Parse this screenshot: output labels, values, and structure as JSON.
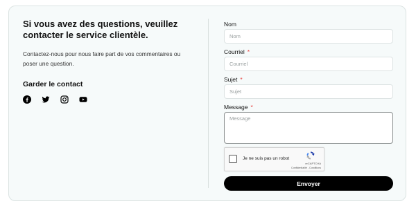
{
  "left": {
    "headline": "Si vous avez des questions, veuillez contacter le service clientèle.",
    "intro": "Contactez-nous pour nous faire part de vos commentaires ou poser une question.",
    "contact_title": "Garder le contact",
    "socials": [
      "facebook-icon",
      "twitter-icon",
      "instagram-icon",
      "youtube-icon"
    ]
  },
  "form": {
    "name": {
      "label": "Nom",
      "placeholder": "Nom",
      "value": ""
    },
    "email": {
      "label": "Courriel",
      "required_mark": "*",
      "placeholder": "Courriel",
      "value": ""
    },
    "subject": {
      "label": "Sujet",
      "required_mark": "*",
      "placeholder": "Sujet",
      "value": ""
    },
    "message": {
      "label": "Message",
      "required_mark": "*",
      "placeholder": "Message",
      "value": ""
    },
    "recaptcha": {
      "label": "Je ne suis pas un robot",
      "brand": "reCAPTCHA",
      "terms": "Confidentialité - Conditions",
      "checked": false
    },
    "submit_label": "Envoyer"
  },
  "colors": {
    "card_background": "#f6fafa",
    "card_border": "#dbe3e2",
    "required": "#e53935",
    "button": "#000000",
    "button_text": "#ffffff"
  }
}
